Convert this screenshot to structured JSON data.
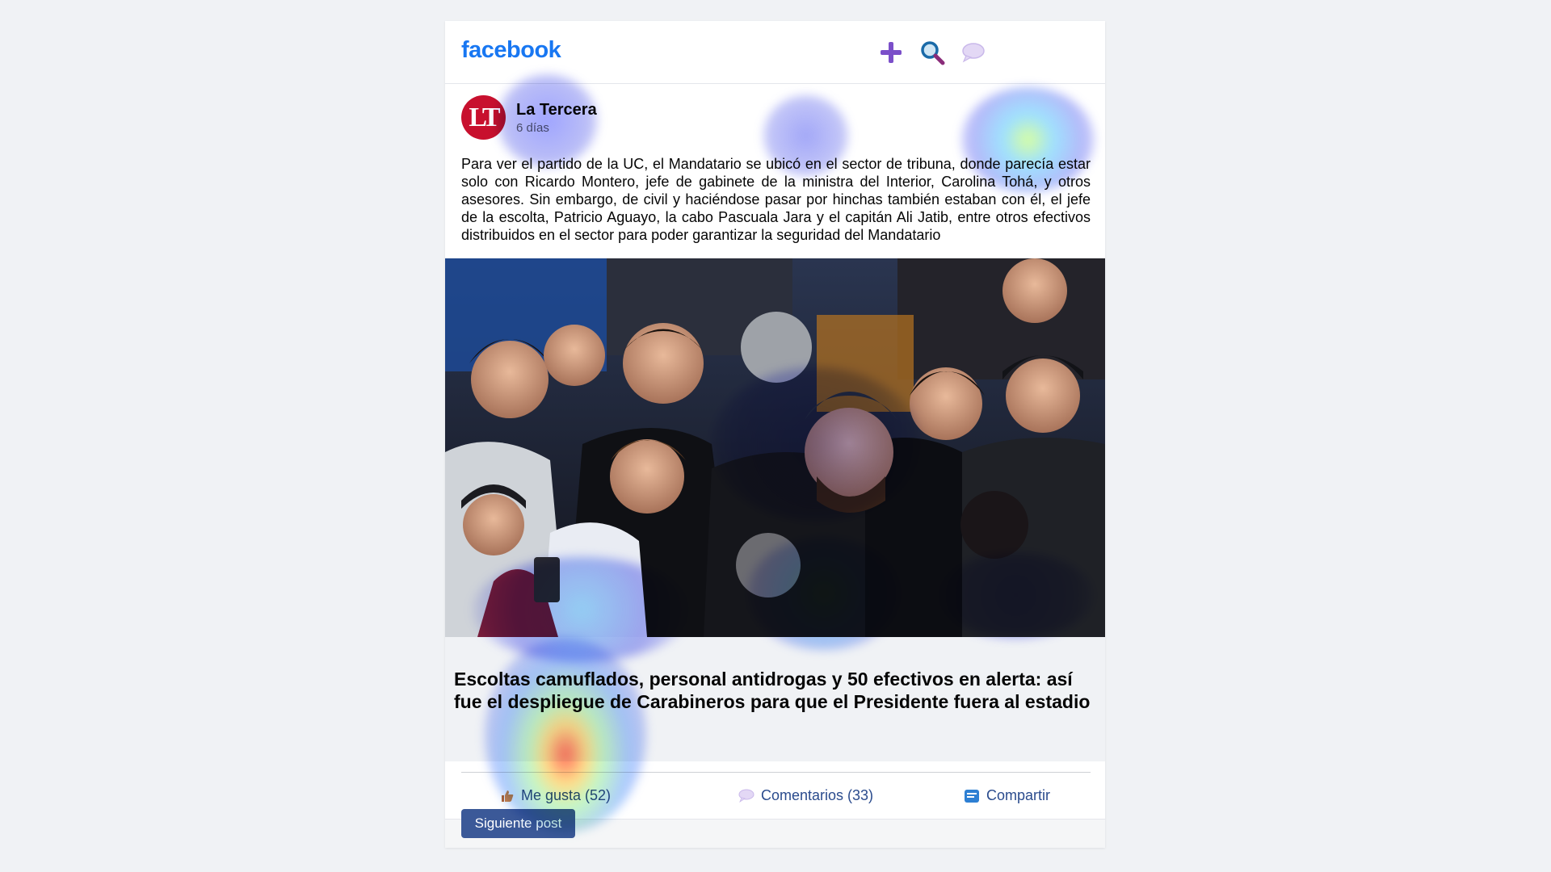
{
  "app": {
    "logo": "facebook",
    "brand_color": "#1877f2",
    "icons": [
      "plus-icon",
      "search-icon",
      "chat-bubble-icon"
    ]
  },
  "post": {
    "page_name": "La Tercera",
    "avatar_initials": "LT",
    "avatar_color": "#c8102e",
    "time": "6 días",
    "text": "Para ver el partido de la UC, el Mandatario se ubicó en el sector de tribuna, donde parecía estar solo con Ricardo Montero, jefe de gabinete de la ministra del Interior, Carolina Tohá, y otros asesores. Sin embargo, de civil y haciéndose pasar por hinchas también estaban con él, el jefe de la escolta, Patricio Aguayo, la cabo Pascuala Jara y el capitán Ali Jatib, entre otros efectivos distribuidos en el sector para poder garantizar la seguridad del Mandatario",
    "image": "crowd-photo",
    "link_title": "Escoltas camuflados, personal antidrogas y 50 efectivos en alerta: así fue el despliegue de Carabineros para que el Presidente fuera al estadio"
  },
  "actions": {
    "like_label": "Me gusta (52)",
    "comment_label": "Comentarios (33)",
    "share_label": "Compartir",
    "action_color": "#2a4b8d"
  },
  "footer": {
    "next_label": "Siguiente post",
    "button_color": "#3b5998"
  }
}
